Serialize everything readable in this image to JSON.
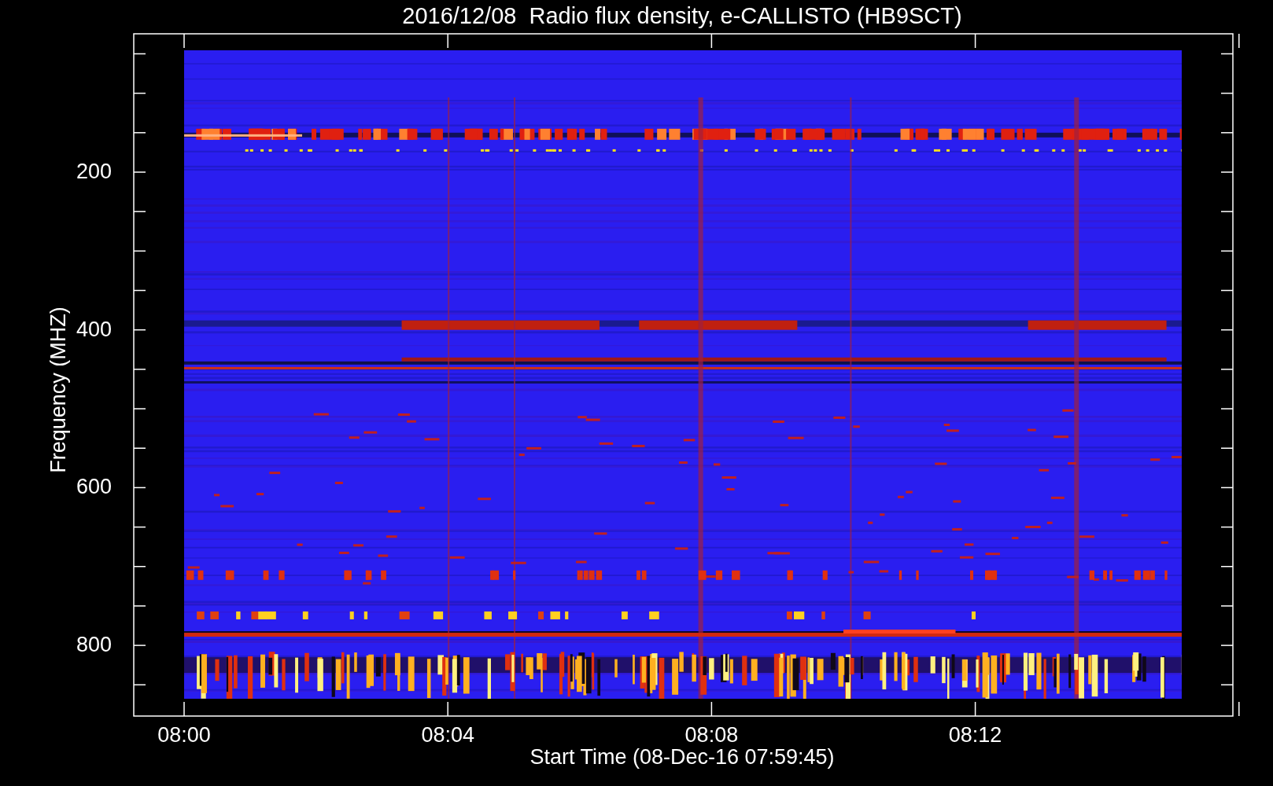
{
  "title": "2016/12/08  Radio flux density, e-CALLISTO (HB9SCT)",
  "y_axis": {
    "label": "Frequency (MHZ)",
    "ticks": [
      "200",
      "400",
      "600",
      "800"
    ]
  },
  "x_axis": {
    "label": "Start Time (08-Dec-16 07:59:45)",
    "ticks": [
      "08:00",
      "08:04",
      "08:08",
      "08:12"
    ]
  }
}
